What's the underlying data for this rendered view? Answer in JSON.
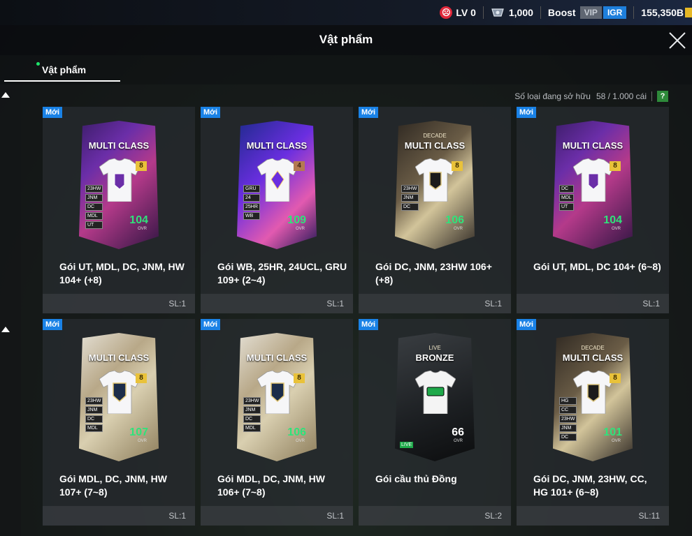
{
  "header": {
    "level": "LV 0",
    "currency1": "1,000",
    "boost_label": "Boost",
    "vip_label": "VIP",
    "igr_label": "IGR",
    "currency2": "155,350B"
  },
  "window": {
    "title": "Vật phẩm"
  },
  "tabs": [
    {
      "label": "Vật phẩm"
    }
  ],
  "inventory": {
    "count_label": "Số loại đang sở hữu",
    "count_value": "58 / 1.000 cái",
    "help_label": "?"
  },
  "cards": [
    {
      "badge": "Mới",
      "title": "MULTI CLASS",
      "name": "Gói UT, MDL, DC, JNM, HW 104+ (+8)",
      "qty": "SL:1",
      "rank": "8",
      "ovr": "104",
      "ovr_label": "OVR",
      "positions": [
        "23HW",
        "JNM",
        "DC",
        "MDL",
        "UT"
      ],
      "style": "purple",
      "icon": "ut-shirt-icon"
    },
    {
      "badge": "Mới",
      "title": "MULTI CLASS",
      "name": "Gói WB, 25HR, 24UCL, GRU 109+ (2~4)",
      "qty": "SL:1",
      "rank": "4",
      "ovr": "109",
      "ovr_label": "OVR",
      "positions": [
        "GRU",
        "24",
        "25HR",
        "WB"
      ],
      "style": "violet",
      "icon": "wb-shirt-icon"
    },
    {
      "badge": "Mới",
      "title": "MULTI CLASS",
      "subtitle": "DECADE",
      "name": "Gói DC, JNM, 23HW 106+ (+8)",
      "qty": "SL:1",
      "rank": "8",
      "ovr": "106",
      "ovr_label": "OVR",
      "positions": [
        "23HW",
        "JNM",
        "DC"
      ],
      "style": "gold",
      "icon": "dc-shirt-icon"
    },
    {
      "badge": "Mới",
      "title": "MULTI CLASS",
      "name": "Gói UT, MDL, DC 104+ (6~8)",
      "qty": "SL:1",
      "rank": "8",
      "ovr": "104",
      "ovr_label": "OVR",
      "positions": [
        "DC",
        "MDL",
        "UT"
      ],
      "style": "purple",
      "icon": "ut-shirt-icon"
    },
    {
      "badge": "Mới",
      "title": "MULTI CLASS",
      "name": "Gói MDL, DC, JNM, HW 107+ (7~8)",
      "qty": "SL:1",
      "rank": "8",
      "ovr": "107",
      "ovr_label": "OVR",
      "positions": [
        "23HW",
        "JNM",
        "DC",
        "MDL"
      ],
      "style": "white",
      "icon": "mdl-shirt-icon"
    },
    {
      "badge": "Mới",
      "title": "MULTI CLASS",
      "name": "Gói MDL, DC, JNM, HW 106+ (7~8)",
      "qty": "SL:1",
      "rank": "8",
      "ovr": "106",
      "ovr_label": "OVR",
      "positions": [
        "23HW",
        "JNM",
        "DC",
        "MDL"
      ],
      "style": "white",
      "icon": "mdl-shirt-icon"
    },
    {
      "badge": "Mới",
      "title": "BRONZE",
      "subtitle": "LIVE",
      "name": "Gói cầu thủ Đồng",
      "qty": "SL:2",
      "ovr": "66",
      "ovr_label": "OVR",
      "positions": [],
      "style": "dark",
      "icon": "live-shirt-icon",
      "live_tag": "LIVE"
    },
    {
      "badge": "Mới",
      "title": "MULTI CLASS",
      "subtitle": "DECADE",
      "name": "Gói DC, JNM, 23HW, CC, HG 101+ (6~8)",
      "qty": "SL:11",
      "rank": "8",
      "ovr": "101",
      "ovr_label": "OVR",
      "positions": [
        "HG",
        "CC",
        "23HW",
        "JNM",
        "DC"
      ],
      "style": "gold",
      "icon": "dc-shirt-icon"
    }
  ]
}
